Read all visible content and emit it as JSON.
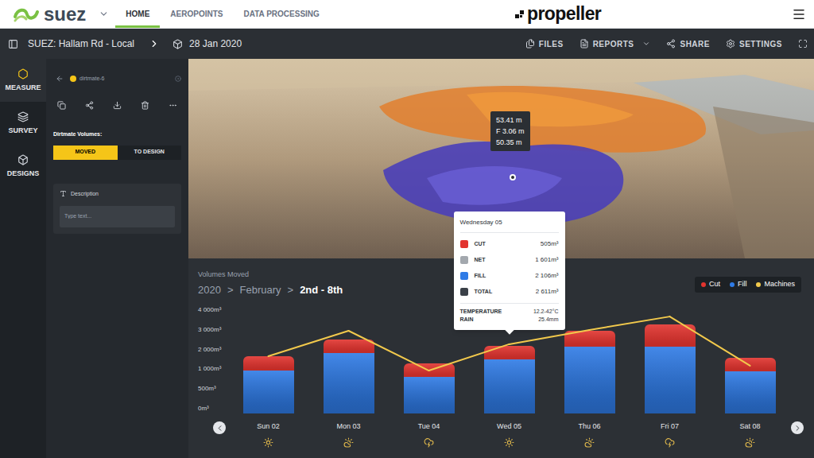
{
  "topbar": {
    "brand": "suez",
    "nav": [
      {
        "label": "HOME",
        "selected": true
      },
      {
        "label": "AEROPOINTS",
        "selected": false
      },
      {
        "label": "DATA PROCESSING",
        "selected": false
      }
    ],
    "logo": "propeller"
  },
  "toolbar": {
    "site": "SUEZ: Hallam Rd - Local",
    "date": "28 Jan 2020",
    "actions": [
      {
        "label": "FILES",
        "dropdown": false
      },
      {
        "label": "REPORTS",
        "dropdown": true
      },
      {
        "label": "SHARE",
        "dropdown": false
      },
      {
        "label": "SETTINGS",
        "dropdown": false
      }
    ]
  },
  "rail": [
    {
      "label": "MEASURE",
      "selected": true
    },
    {
      "label": "SURVEY",
      "selected": false
    },
    {
      "label": "DESIGNS",
      "selected": false
    }
  ],
  "panel": {
    "name": "dirtmate-6",
    "section": "Dirtmate Volumes:",
    "modes": [
      {
        "label": "MOVED",
        "selected": true
      },
      {
        "label": "TO DESIGN",
        "selected": false
      }
    ],
    "description": {
      "label": "Description",
      "placeholder": "Type text..."
    }
  },
  "viewer": {
    "marker": [
      "53.41 m",
      "F 3.06 m",
      "50.35 m"
    ]
  },
  "chart": {
    "title": "Volumes Moved",
    "separator": ">",
    "breadcrumb": [
      {
        "label": "2020",
        "selected": false
      },
      {
        "label": "February",
        "selected": false
      },
      {
        "label": "2nd - 8th",
        "selected": true
      }
    ],
    "y_ticks": [
      "4 000m³",
      "3 000m³",
      "2 000m³",
      "1 000m³",
      "500m³",
      "0m³"
    ],
    "series": [
      {
        "label": "Cut",
        "color": "#e2342f",
        "values": [
          560,
          520,
          525,
          505,
          615,
          860,
          525
        ]
      },
      {
        "label": "Fill",
        "color": "#2f7be6",
        "values": [
          1650,
          2340,
          1415,
          2106,
          2585,
          2585,
          1630
        ]
      },
      {
        "label": "Machines",
        "color": "#f2c94c",
        "values": [
          2215,
          3200,
          1660,
          2680,
          3230,
          3750,
          1850
        ]
      }
    ],
    "days": [
      {
        "label": "Sun 02",
        "weather": "sun",
        "hovered": false
      },
      {
        "label": "Mon 03",
        "weather": "cloud-sun",
        "hovered": false
      },
      {
        "label": "Tue 04",
        "weather": "storm",
        "hovered": false
      },
      {
        "label": "Wed 05",
        "weather": "sun",
        "hovered": true
      },
      {
        "label": "Thu 06",
        "weather": "cloud-sun",
        "hovered": false
      },
      {
        "label": "Fri 07",
        "weather": "storm",
        "hovered": false
      },
      {
        "label": "Sat 08",
        "weather": "cloud-sun",
        "hovered": false
      }
    ],
    "tooltip": {
      "title": "Wednesday 05",
      "rows": [
        {
          "label": "CUT",
          "value": "505m³",
          "color": "#e2342f"
        },
        {
          "label": "NET",
          "value": "1 601m³",
          "color": "#a3a8ae"
        },
        {
          "label": "FILL",
          "value": "2 106m³",
          "color": "#2f7be6"
        },
        {
          "label": "TOTAL",
          "value": "2 611m³",
          "color": "#3a4048"
        }
      ],
      "weather": [
        {
          "label": "TEMPERATURE",
          "value": "12.2-42°C"
        },
        {
          "label": "RAIN",
          "value": "25.4mm"
        }
      ]
    }
  }
}
